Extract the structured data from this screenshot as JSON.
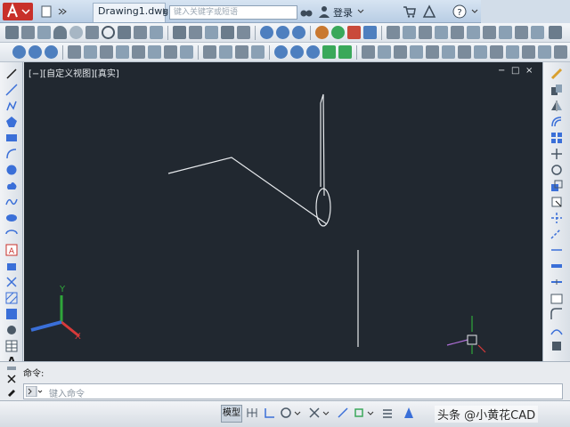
{
  "window": {
    "title": "Drawing1.dwg",
    "search_placeholder": "键入关键字或短语",
    "login_label": "登录",
    "help_label": "?"
  },
  "viewport": {
    "label": "[−][自定义视图][真实]",
    "minimize": "−",
    "restore": "□",
    "close": "×"
  },
  "command": {
    "prompt_label": "命令:",
    "input_placeholder": "键入命令"
  },
  "statusbar": {
    "model_label": "模型"
  },
  "ucs": {
    "x_label": "X",
    "y_label": "Y"
  },
  "watermark": "头条 @小黄花CAD",
  "colors": {
    "canvas_bg": "#212830",
    "line": "#e6e9ec",
    "axis_x": "#d83a3a",
    "axis_y": "#2fa63a",
    "axis_z": "#3a6fd8",
    "app_red": "#c8302a"
  }
}
